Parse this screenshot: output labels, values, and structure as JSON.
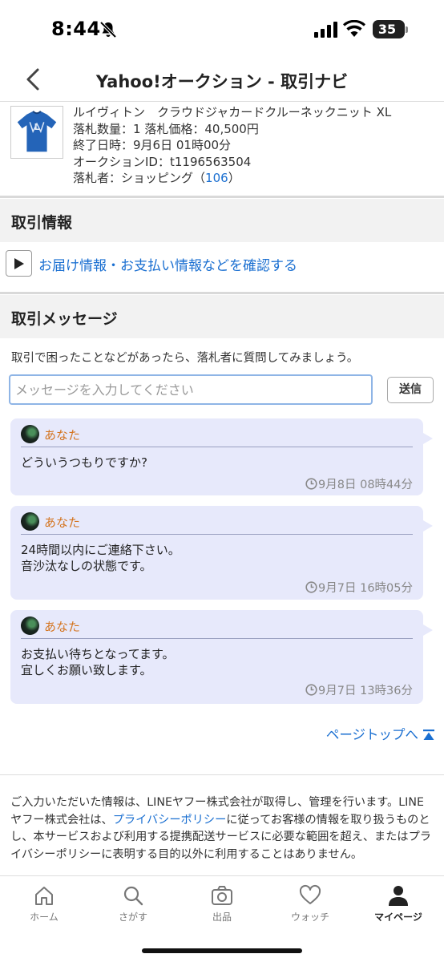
{
  "status_bar": {
    "time": "8:44",
    "battery": "35"
  },
  "header": {
    "title": "Yahoo!オークション - 取引ナビ"
  },
  "item": {
    "name": "ルイヴィトン　クラウドジャカードクルーネックニット XL",
    "qty_label": "落札数量：",
    "qty": "1",
    "price_label": "落札価格：",
    "price": "40,500円",
    "end_label": "終了日時：",
    "end": "9月6日 01時00分",
    "auction_id_label": "オークションID：",
    "auction_id": "t1196563504",
    "winner_label": "落札者：",
    "winner": "ショッピング",
    "winner_rating": "106"
  },
  "trade_info": {
    "heading": "取引情報",
    "link": "お届け情報・お支払い情報などを確認する"
  },
  "messages_section": {
    "heading": "取引メッセージ",
    "hint": "取引で困ったことなどがあったら、落札者に質問してみましょう。",
    "input_placeholder": "メッセージを入力してください",
    "send_label": "送信"
  },
  "messages": [
    {
      "sender": "あなた",
      "line1": "どういうつもりですか?",
      "line2": "",
      "timestamp": "9月8日 08時44分"
    },
    {
      "sender": "あなた",
      "line1": "24時間以内にご連絡下さい。",
      "line2": "音沙汰なしの状態です。",
      "timestamp": "9月7日 16時05分"
    },
    {
      "sender": "あなた",
      "line1": "お支払い待ちとなってます。",
      "line2": "宜しくお願い致します。",
      "timestamp": "9月7日 13時36分"
    }
  ],
  "page_top": "ページトップへ",
  "disclaimer": {
    "part1": "ご入力いただいた情報は、LINEヤフー株式会社が取得し、管理を行います。LINEヤフー株式会社は、",
    "privacy_link": "プライバシーポリシー",
    "part2": "に従ってお客様の情報を取り扱うものとし、本サービスおよび利用する提携配送サービスに必要な範囲を超え、またはプライバシーポリシーに表明する目的以外に利用することはありません。"
  },
  "tabs": {
    "home": "ホーム",
    "search": "さがす",
    "sell": "出品",
    "watch": "ウォッチ",
    "mypage": "マイページ"
  },
  "colors": {
    "link": "#1a6fd1",
    "bubble": "#e7e9fb",
    "sender": "#d4741f",
    "section_bg": "#f2f2f2"
  }
}
